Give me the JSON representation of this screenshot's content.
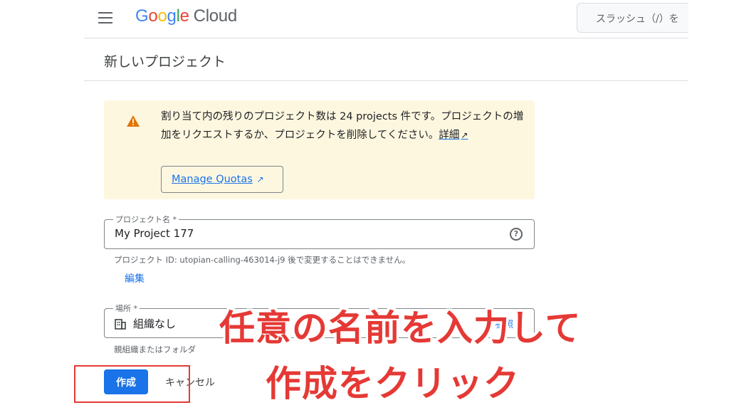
{
  "header": {
    "menu_icon": "hamburger-menu-icon",
    "logo": {
      "G": "G",
      "o1": "o",
      "o2": "o",
      "g": "g",
      "l": "l",
      "e": "e",
      "cloud": "Cloud"
    },
    "search_placeholder": "スラッシュ（/）を"
  },
  "page": {
    "title": "新しいプロジェクト"
  },
  "banner": {
    "icon": "warning-icon",
    "text": "割り当て内の残りのプロジェクト数は 24 projects 件です。プロジェクトの増加をリクエストするか、プロジェクトを削除してください。",
    "detail_link": "詳細",
    "manage_quotas": "Manage Quotas",
    "colors": {
      "background": "#fef7e0",
      "icon": "#e37400",
      "link": "#1a73e8"
    }
  },
  "project_name": {
    "label": "プロジェクト名 *",
    "value": "My Project 177",
    "help_icon": "help-circle-icon",
    "hint": "プロジェクト ID: utopian-calling-463014-j9 後で変更することはできません。",
    "edit": "編集"
  },
  "location": {
    "label": "場所 *",
    "icon": "organization-icon",
    "value": "組織なし",
    "browse": "参照",
    "hint": "親組織またはフォルダ"
  },
  "actions": {
    "create": "作成",
    "cancel": "キャンセル",
    "primary_color": "#1a73e8"
  },
  "overlay": {
    "line1": "任意の名前を入力して",
    "line2": "作成をクリック",
    "color": "#e53935"
  }
}
